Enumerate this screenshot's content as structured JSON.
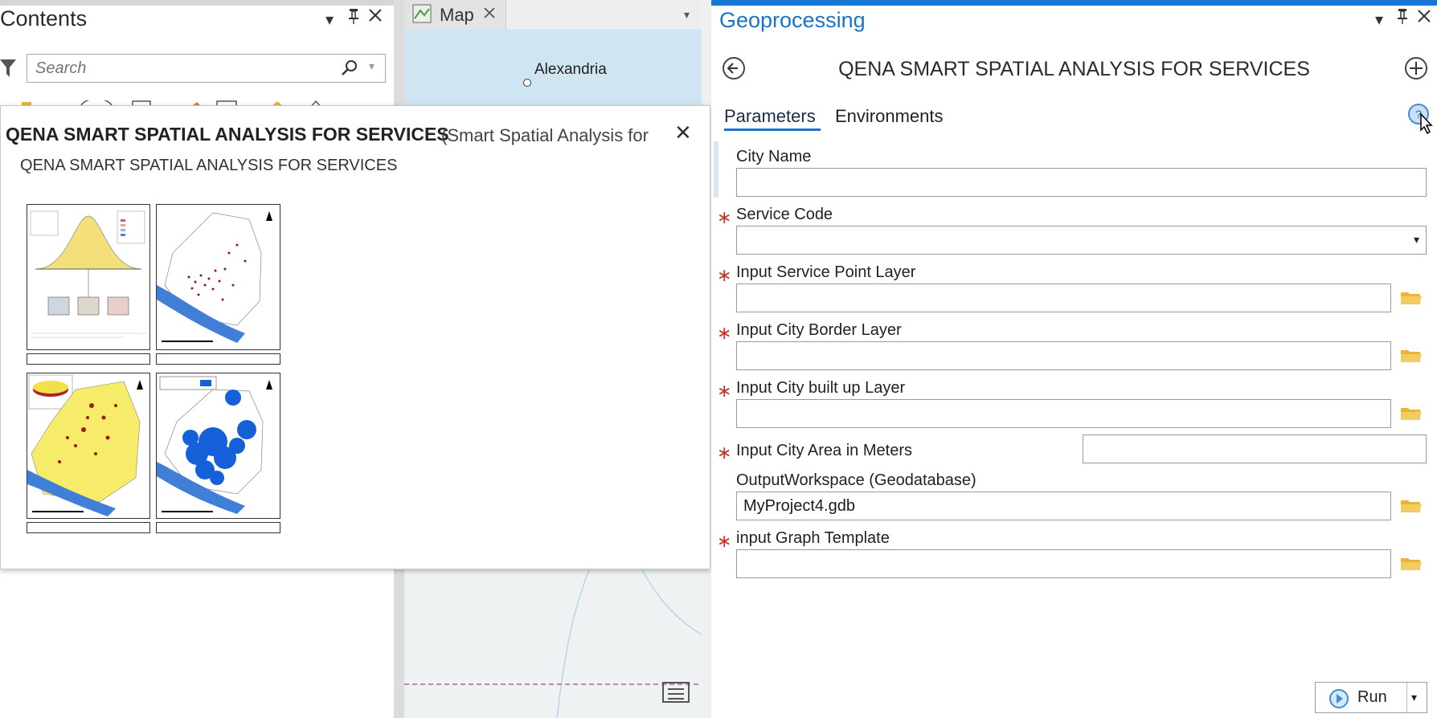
{
  "contents": {
    "title": "Contents",
    "search": {
      "placeholder": "Search",
      "value": ""
    }
  },
  "map": {
    "tab_label": "Map",
    "city_label": "Alexandria"
  },
  "popup": {
    "title": "QENA SMART SPATIAL ANALYSIS FOR SERVICES",
    "subtitle": "(Smart Spatial Analysis for",
    "description": "QENA SMART SPATIAL ANALYSIS FOR SERVICES"
  },
  "geoprocessing": {
    "title": "Geoprocessing",
    "tool_name": "QENA SMART SPATIAL ANALYSIS FOR SERVICES",
    "tabs": [
      "Parameters",
      "Environments"
    ],
    "active_tab": "Parameters",
    "parameters": [
      {
        "label": "City Name",
        "required": false,
        "value": "",
        "type": "text"
      },
      {
        "label": "Service Code",
        "required": true,
        "value": "",
        "type": "dropdown"
      },
      {
        "label": "Input Service Point Layer",
        "required": true,
        "value": "",
        "type": "browse"
      },
      {
        "label": "Input City Border Layer",
        "required": true,
        "value": "",
        "type": "browse"
      },
      {
        "label": "Input City built up Layer",
        "required": true,
        "value": "",
        "type": "browse"
      },
      {
        "label": "Input City Area in Meters",
        "required": true,
        "value": "",
        "type": "inline"
      },
      {
        "label": "OutputWorkspace (Geodatabase)",
        "required": false,
        "value": "MyProject4.gdb",
        "type": "browse"
      },
      {
        "label": "input Graph Template",
        "required": true,
        "value": "",
        "type": "browse"
      }
    ],
    "run_label": "Run"
  },
  "colors": {
    "accent": "#1478d4",
    "required_star": "#c0392b",
    "folder": "#e8b43a",
    "run_icon": "#3b8fd6"
  },
  "icons": [
    "filter-icon",
    "search-icon",
    "pin-icon",
    "close-icon",
    "menu-icon",
    "back-icon",
    "add-icon",
    "help-icon",
    "folder-icon",
    "play-icon",
    "dropdown-icon",
    "map-icon"
  ]
}
